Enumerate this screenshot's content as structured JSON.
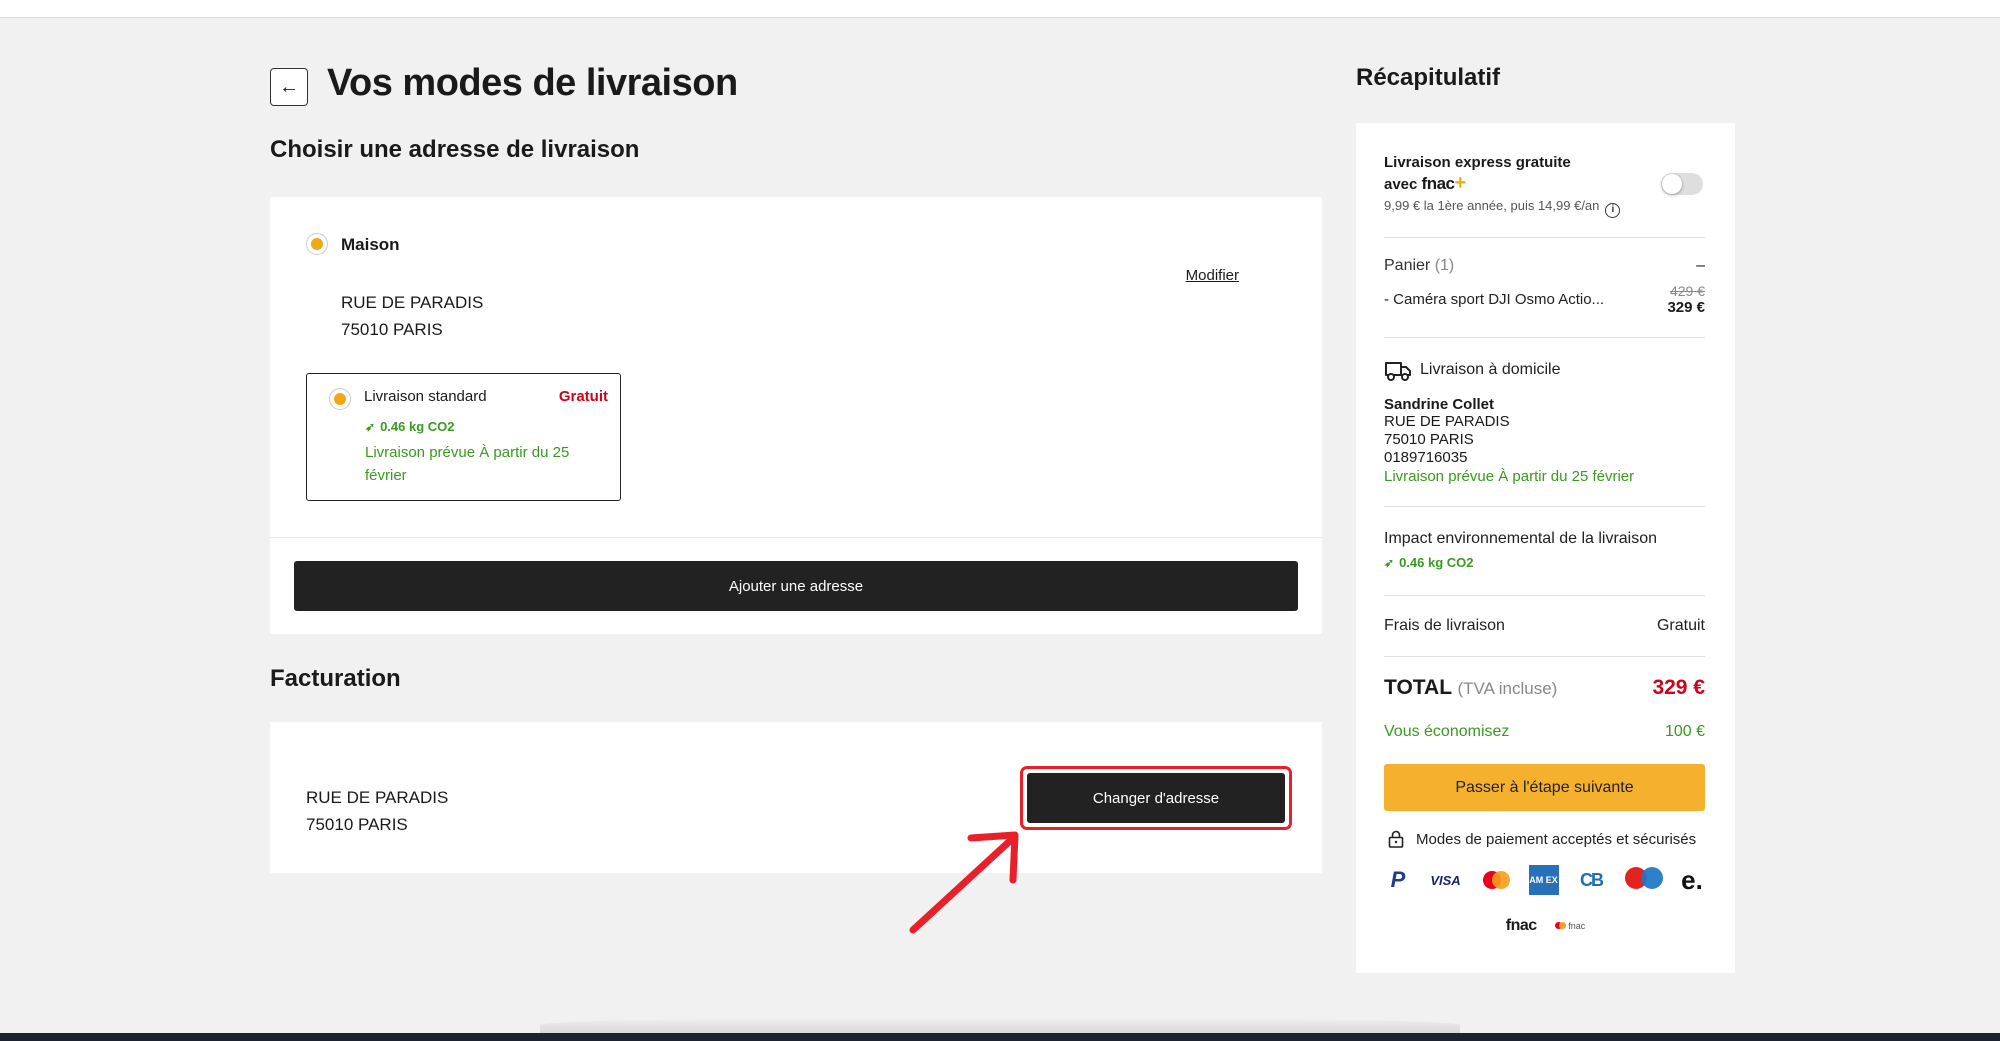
{
  "page": {
    "back_icon": "arrow-left-icon",
    "title": "Vos modes de livraison"
  },
  "delivery_address": {
    "section_title": "Choisir une adresse de livraison",
    "address": {
      "name": "Maison",
      "street": "RUE DE PARADIS",
      "city": "75010 PARIS",
      "modify_label": "Modifier"
    },
    "shipping_option": {
      "name": "Livraison standard",
      "price": "Gratuit",
      "co2": "0.46 kg CO2",
      "date": "Livraison prévue À partir du 25 février"
    },
    "add_address_label": "Ajouter une adresse"
  },
  "billing": {
    "section_title": "Facturation",
    "street": "RUE DE PARADIS",
    "city": "75010 PARIS",
    "change_label": "Changer d'adresse"
  },
  "summary": {
    "title": "Récapitulatif",
    "fnac_plus": {
      "title_line1": "Livraison express gratuite",
      "title_line2": "avec",
      "logo": "fnac",
      "plus": "+",
      "subtitle": "9,99 € la 1ère année, puis 14,99 €/an",
      "info_icon": "i",
      "toggle_on": false
    },
    "cart": {
      "label": "Panier",
      "count": "(1)",
      "collapse": "–",
      "item": "- Caméra sport DJI Osmo Actio...",
      "old_price": "429 €",
      "price": "329 €"
    },
    "delivery": {
      "title": "Livraison à domicile",
      "name": "Sandrine Collet",
      "street": "RUE DE PARADIS",
      "city": "75010 PARIS",
      "phone": "0189716035",
      "date": "Livraison prévue À partir du 25 février"
    },
    "impact": {
      "title": "Impact environnemental de la livraison",
      "co2": "0.46 kg CO2"
    },
    "fees": {
      "label": "Frais de livraison",
      "value": "Gratuit"
    },
    "total": {
      "label": "TOTAL",
      "tax_note": "(TVA incluse)",
      "value": "329 €"
    },
    "savings": {
      "label": "Vous économisez",
      "value": "100 €"
    },
    "next_label": "Passer à l'étape suivante",
    "payment": {
      "title": "Modes de paiement acceptés et sécurisés",
      "visa": "VISA",
      "amex": "AM EX",
      "cb": "CB",
      "maestro": "maestro",
      "eshop": "e.",
      "fnac": "fnac",
      "fnac_card": "fnac"
    }
  },
  "colors": {
    "accent_yellow": "#f5b02e",
    "radio_orange": "#f2a715",
    "price_red": "#d0021b",
    "eco_green": "#3a9a1f",
    "highlight_red": "#e8202a",
    "button_dark": "#222222"
  }
}
